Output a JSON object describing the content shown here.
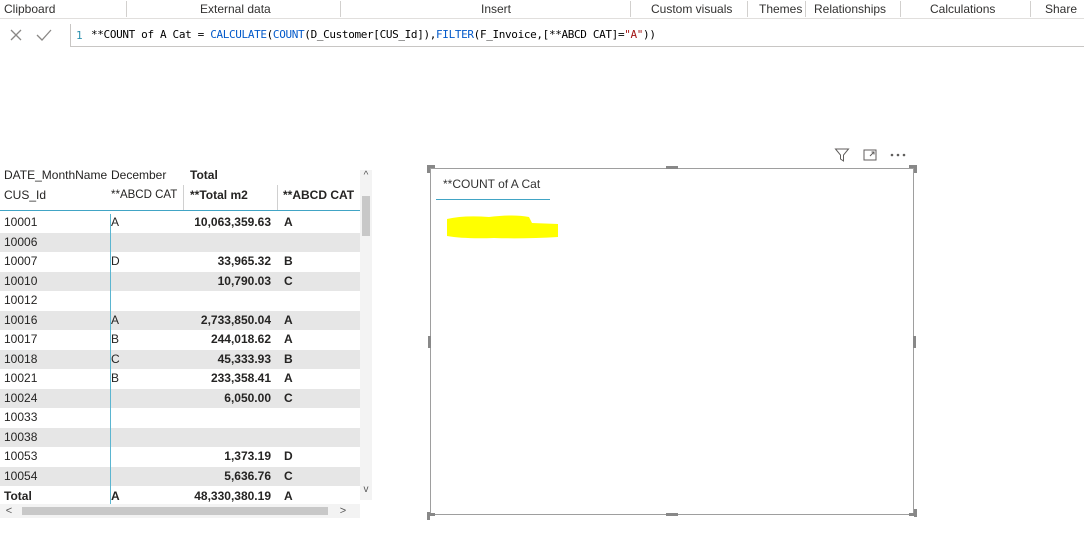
{
  "ribbon": {
    "groups": [
      "Clipboard",
      "External data",
      "Insert",
      "Custom visuals",
      "Themes",
      "Relationships",
      "Calculations",
      "Share"
    ]
  },
  "formula_bar": {
    "cancel_icon": "close-icon",
    "commit_icon": "check-icon",
    "line_number": "1",
    "measure_name": "**COUNT of A Cat = ",
    "fn_calculate": "CALCULATE",
    "paren_open": "(",
    "fn_count": "COUNT",
    "count_arg": "(D_Customer[CUS_Id]),",
    "fn_filter": "FILTER",
    "filter_arg": "(F_Invoice,[**ABCD CAT]=",
    "filter_value": "\"A\"",
    "paren_close": "))"
  },
  "table": {
    "header_row1": {
      "col1": "DATE_MonthName",
      "col2": "December",
      "col3": "Total"
    },
    "header_row2": {
      "col1": "CUS_Id",
      "col2": "**ABCD CAT",
      "col3": "**Total m2",
      "col4": "**ABCD CAT"
    },
    "rows": [
      {
        "id": "10001",
        "cat": "A",
        "total": "10,063,359.63",
        "cat2": "A"
      },
      {
        "id": "10006",
        "cat": "",
        "total": "",
        "cat2": ""
      },
      {
        "id": "10007",
        "cat": "D",
        "total": "33,965.32",
        "cat2": "B"
      },
      {
        "id": "10010",
        "cat": "",
        "total": "10,790.03",
        "cat2": "C"
      },
      {
        "id": "10012",
        "cat": "",
        "total": "",
        "cat2": ""
      },
      {
        "id": "10016",
        "cat": "A",
        "total": "2,733,850.04",
        "cat2": "A"
      },
      {
        "id": "10017",
        "cat": "B",
        "total": "244,018.62",
        "cat2": "A"
      },
      {
        "id": "10018",
        "cat": "C",
        "total": "45,333.93",
        "cat2": "B"
      },
      {
        "id": "10021",
        "cat": "B",
        "total": "233,358.41",
        "cat2": "A"
      },
      {
        "id": "10024",
        "cat": "",
        "total": "6,050.00",
        "cat2": "C"
      },
      {
        "id": "10033",
        "cat": "",
        "total": "",
        "cat2": ""
      },
      {
        "id": "10038",
        "cat": "",
        "total": "",
        "cat2": ""
      },
      {
        "id": "10053",
        "cat": "",
        "total": "1,373.19",
        "cat2": "D"
      },
      {
        "id": "10054",
        "cat": "",
        "total": "5,636.76",
        "cat2": "C"
      }
    ],
    "total_row": {
      "id": "Total",
      "cat": "A",
      "total": "48,330,380.19",
      "cat2": "A"
    },
    "scroll_up": "^",
    "scroll_down": "v",
    "scroll_left": "<",
    "scroll_right": ">"
  },
  "card": {
    "title": "**COUNT of A Cat",
    "value_highlight_color": "#ffff00"
  },
  "visual_header": {
    "icons": [
      "filter-icon",
      "focus-mode-icon",
      "more-options-icon"
    ]
  },
  "colors": {
    "accent": "#41a4c5",
    "dax_keyword": "#035aca",
    "dax_string": "#a31515",
    "row_shade": "#e6e6e6"
  }
}
